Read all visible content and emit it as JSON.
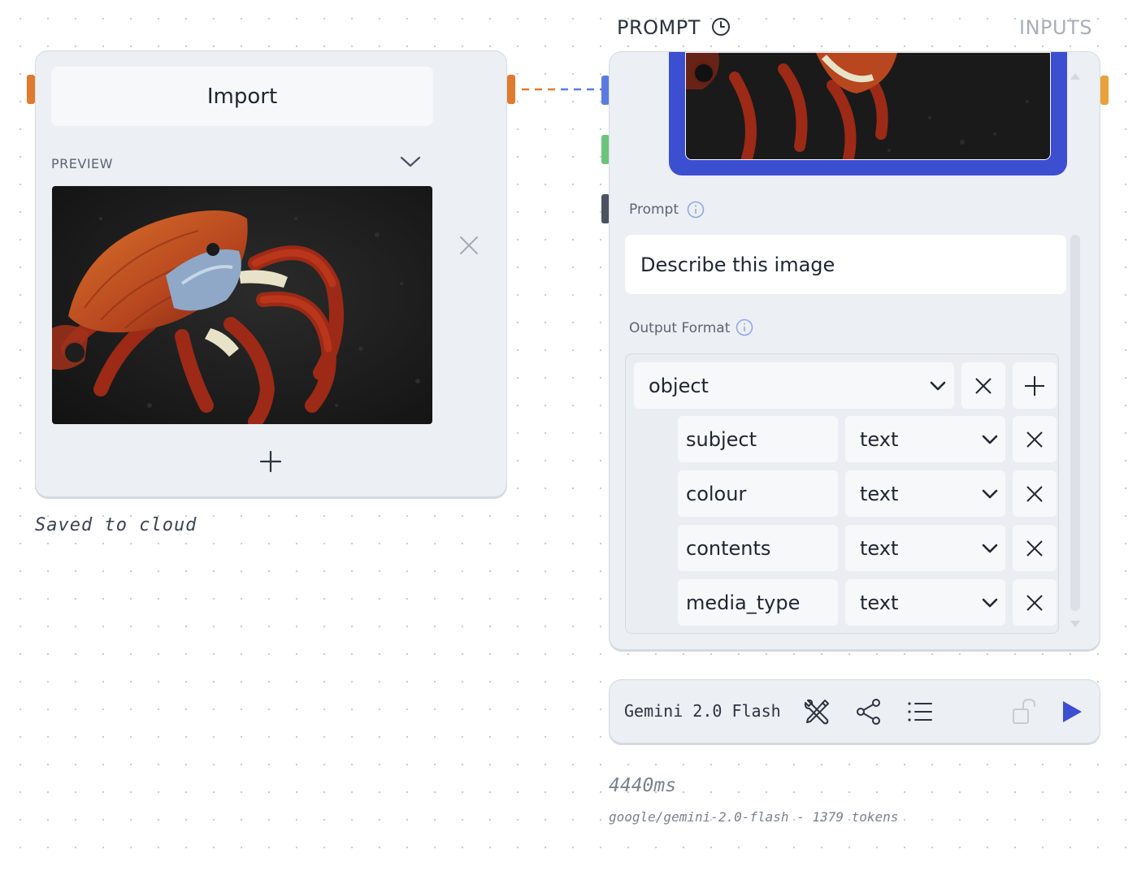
{
  "import_node": {
    "import_label": "Import",
    "preview_label": "PREVIEW",
    "image_subject": "red crab on dark volcanic rock",
    "status": "Saved to cloud"
  },
  "prompt_node": {
    "header": "PROMPT",
    "inputs_label": "INPUTS",
    "prompt_label": "Prompt",
    "prompt_value": "Describe this image",
    "output_format_label": "Output Format",
    "root_type": "object",
    "fields": [
      {
        "name": "subject",
        "type": "text"
      },
      {
        "name": "colour",
        "type": "text"
      },
      {
        "name": "contents",
        "type": "text"
      },
      {
        "name": "media_type",
        "type": "text"
      }
    ]
  },
  "model_bar": {
    "model_name": "Gemini 2.0 Flash",
    "icons": [
      "tools-icon",
      "share-icon",
      "list-icon",
      "unlock-icon",
      "play-icon"
    ]
  },
  "run_info": {
    "duration": "4440ms",
    "meta": "google/gemini-2.0-flash - 1379 tokens"
  },
  "colors": {
    "accent_blue": "#3c4fd1",
    "port_orange": "#e07a2e",
    "port_blue": "#5b7be0",
    "port_green": "#6cc47a",
    "port_dark": "#4b5260",
    "port_amber": "#e8a23a"
  }
}
